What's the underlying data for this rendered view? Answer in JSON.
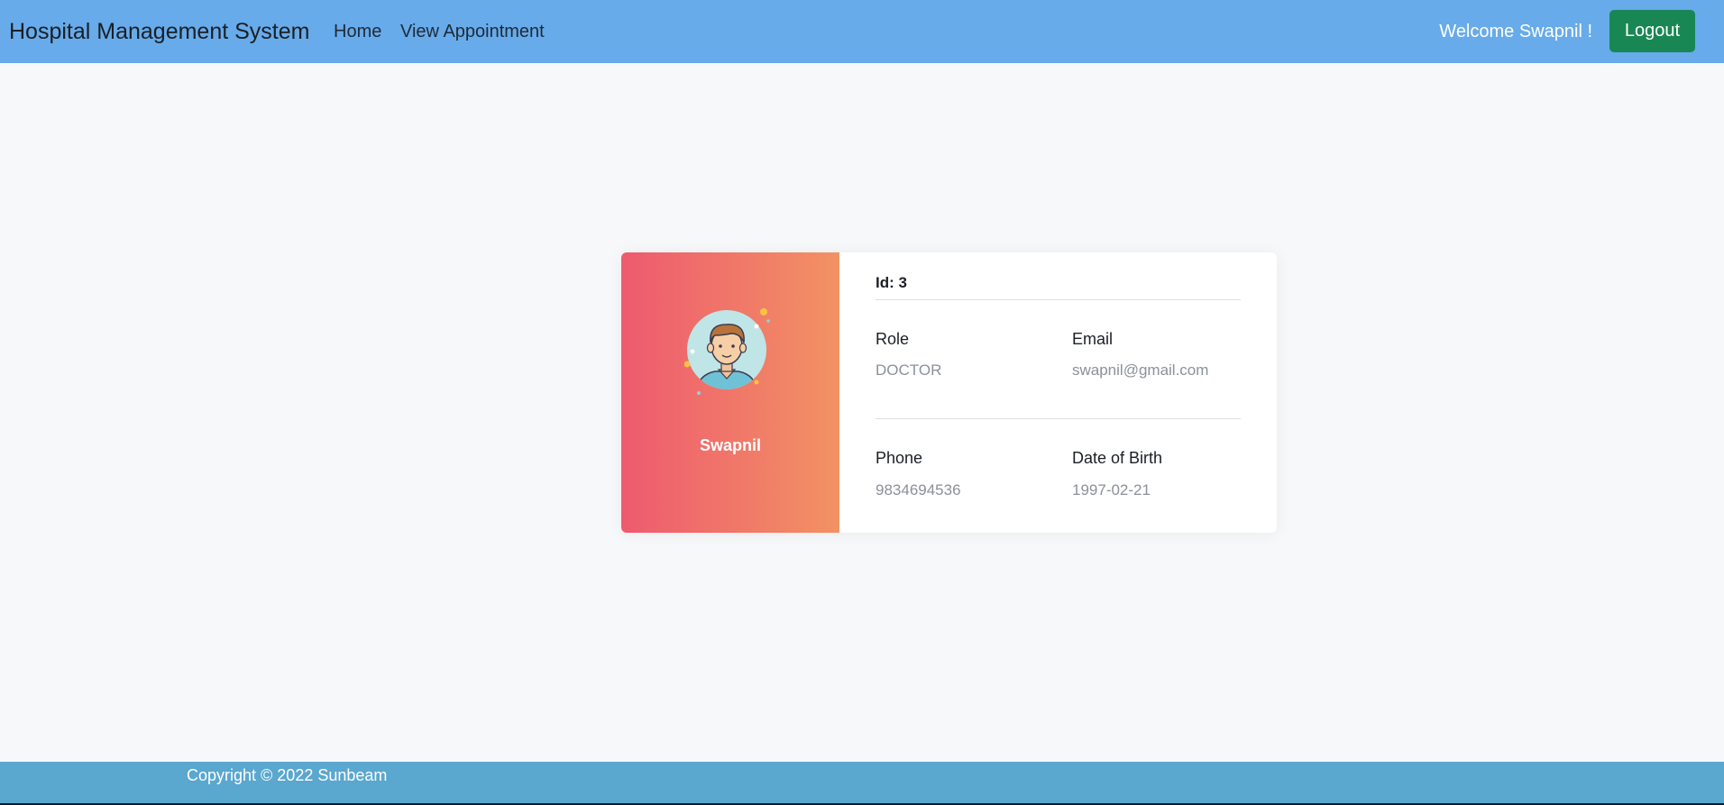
{
  "header": {
    "brand": "Hospital Management System",
    "nav": {
      "home": "Home",
      "view_appointment": "View Appointment"
    },
    "welcome": "Welcome Swapnil !",
    "logout_label": "Logout"
  },
  "profile": {
    "name": "Swapnil",
    "id_text": "Id: 3",
    "role_label": "Role",
    "role_value": "DOCTOR",
    "email_label": "Email",
    "email_value": "swapnil@gmail.com",
    "phone_label": "Phone",
    "phone_value": "9834694536",
    "dob_label": "Date of Birth",
    "dob_value": "1997-02-21"
  },
  "footer": {
    "copyright": "Copyright © 2022 Sunbeam"
  },
  "colors": {
    "navbar": "#67abeb",
    "logout_button": "#198754",
    "card_gradient_start": "#ee5a6f",
    "card_gradient_end": "#f29263",
    "footer": "#5aa7cf"
  },
  "icons": {
    "avatar": "male-user-avatar-icon"
  }
}
